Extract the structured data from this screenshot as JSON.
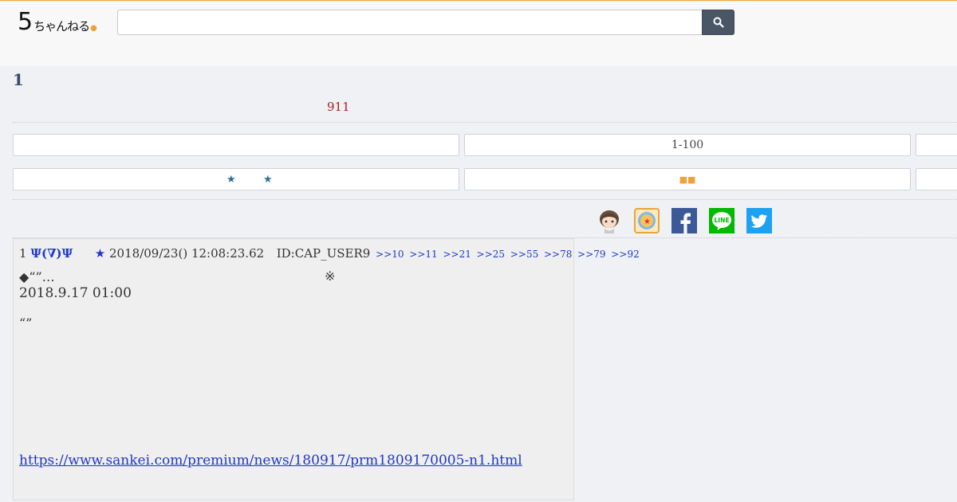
{
  "header": {
    "logo_main": "5",
    "logo_kana": "ちゃんねる",
    "search": {
      "value": "",
      "placeholder": ""
    }
  },
  "thread": {
    "title": "1",
    "res_count": "911"
  },
  "nav": {
    "row1": [
      "",
      "1-100",
      ""
    ],
    "row2_left_stars": [
      "★",
      "★"
    ],
    "row2_mid": "■■",
    "row2_right": ""
  },
  "share": {
    "items": [
      "avatar-mascot-icon",
      "app-badge-icon",
      "facebook-icon",
      "line-icon",
      "twitter-icon"
    ],
    "line_label": "LINE"
  },
  "post": {
    "number": "1",
    "name": "Ψ(∇)Ψ",
    "star": "★",
    "date": "2018/09/23() 12:08:23.62",
    "id": "ID:CAP_USER9",
    "anchors": [
      ">>10",
      ">>11",
      ">>21",
      ">>25",
      ">>55",
      ">>78",
      ">>79",
      ">>92"
    ],
    "line1": "◆“”…",
    "line1_mark": "※",
    "line2": "2018.9.17 01:00",
    "line3": "“”",
    "link": "https://www.sankei.com/premium/news/180917/prm1809170005-n1.html"
  },
  "colors": {
    "accent": "#f0a23a",
    "link": "#1f37c9",
    "count": "#b31a1a",
    "search_button": "#4a5566",
    "facebook": "#3b5998",
    "line": "#00b900",
    "twitter": "#1da1f2"
  }
}
